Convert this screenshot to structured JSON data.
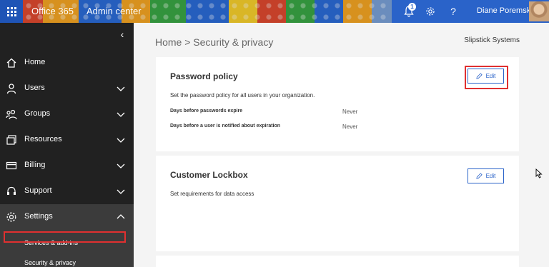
{
  "topbar": {
    "app_name": "Office 365",
    "app_section": "Admin center",
    "notification_count": "1",
    "help_glyph": "?",
    "user_name": "Diane Poremsky",
    "icons": [
      "waffle-icon",
      "bell-icon",
      "gear-icon",
      "help-icon",
      "avatar"
    ]
  },
  "sidebar": {
    "collapse_glyph": "‹",
    "items": [
      {
        "label": "Home",
        "icon": "home-icon"
      },
      {
        "label": "Users",
        "icon": "user-icon",
        "expanded": false
      },
      {
        "label": "Groups",
        "icon": "groups-icon",
        "expanded": false
      },
      {
        "label": "Resources",
        "icon": "resources-icon",
        "expanded": false
      },
      {
        "label": "Billing",
        "icon": "billing-icon",
        "expanded": false
      },
      {
        "label": "Support",
        "icon": "support-icon",
        "expanded": false
      },
      {
        "label": "Settings",
        "icon": "settings-gear-icon",
        "expanded": true
      }
    ],
    "settings_sub": [
      {
        "label": "Services & add-ins"
      },
      {
        "label": "Security & privacy",
        "selected": true
      }
    ]
  },
  "main": {
    "breadcrumb": "Home > Security & privacy",
    "org_name": "Slipstick Systems",
    "password_policy": {
      "title": "Password policy",
      "description": "Set the password policy for all users in your organization.",
      "rows": [
        {
          "label": "Days before passwords expire",
          "value": "Never"
        },
        {
          "label": "Days before a user is notified about expiration",
          "value": "Never"
        }
      ],
      "edit_label": "Edit"
    },
    "customer_lockbox": {
      "title": "Customer Lockbox",
      "description": "Set requirements for data access",
      "edit_label": "Edit"
    }
  },
  "colors": {
    "accent": "#2a63c9",
    "sidebar_bg": "#212121",
    "sidebar_active_bg": "#3b3b3b",
    "highlight_red": "#e03030"
  }
}
